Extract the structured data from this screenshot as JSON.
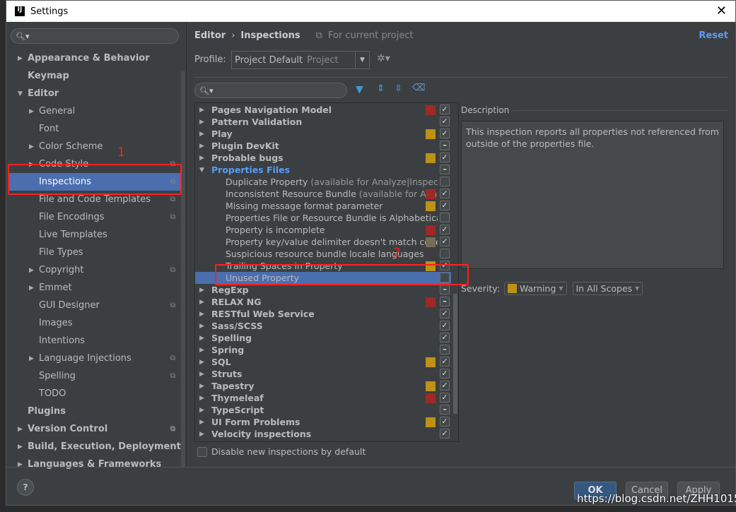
{
  "window": {
    "title": "Settings",
    "close": "✕"
  },
  "sidebar": {
    "items": [
      {
        "label": "Appearance & Behavior",
        "level": 0,
        "arrow": "right",
        "bold": true
      },
      {
        "label": "Keymap",
        "level": 0,
        "bold": true
      },
      {
        "label": "Editor",
        "level": 0,
        "arrow": "down",
        "bold": true
      },
      {
        "label": "General",
        "level": 1,
        "arrow": "right"
      },
      {
        "label": "Font",
        "level": 1
      },
      {
        "label": "Color Scheme",
        "level": 1,
        "arrow": "right"
      },
      {
        "label": "Code Style",
        "level": 1,
        "arrow": "right",
        "copy": true
      },
      {
        "label": "Inspections",
        "level": 1,
        "copy": true,
        "selected": true
      },
      {
        "label": "File and Code Templates",
        "level": 1,
        "copy": true
      },
      {
        "label": "File Encodings",
        "level": 1,
        "copy": true
      },
      {
        "label": "Live Templates",
        "level": 1
      },
      {
        "label": "File Types",
        "level": 1
      },
      {
        "label": "Copyright",
        "level": 1,
        "arrow": "right",
        "copy": true
      },
      {
        "label": "Emmet",
        "level": 1,
        "arrow": "right"
      },
      {
        "label": "GUI Designer",
        "level": 1,
        "copy": true
      },
      {
        "label": "Images",
        "level": 1
      },
      {
        "label": "Intentions",
        "level": 1
      },
      {
        "label": "Language Injections",
        "level": 1,
        "arrow": "right",
        "copy": true
      },
      {
        "label": "Spelling",
        "level": 1,
        "copy": true
      },
      {
        "label": "TODO",
        "level": 1
      },
      {
        "label": "Plugins",
        "level": 0,
        "bold": true
      },
      {
        "label": "Version Control",
        "level": 0,
        "arrow": "right",
        "bold": true,
        "copy": true
      },
      {
        "label": "Build, Execution, Deployment",
        "level": 0,
        "arrow": "right",
        "bold": true
      },
      {
        "label": "Languages & Frameworks",
        "level": 0,
        "arrow": "right",
        "bold": true
      }
    ]
  },
  "header": {
    "crumb1": "Editor",
    "sep": "›",
    "crumb2": "Inspections",
    "scope": "For current project",
    "reset": "Reset"
  },
  "profile": {
    "label": "Profile:",
    "value": "Project Default",
    "hint": "Project"
  },
  "colors": {
    "error": "#9e2927",
    "warning": "#be9117",
    "weak": "#756d56",
    "accent": "#4b6eaf",
    "link": "#589df6"
  },
  "tree": {
    "rows": [
      {
        "label": "Pages Navigation Model",
        "group": true,
        "sev": "error",
        "check": "on"
      },
      {
        "label": "Pattern Validation",
        "group": true,
        "check": "on"
      },
      {
        "label": "Play",
        "group": true,
        "sev": "warning",
        "check": "on"
      },
      {
        "label": "Plugin DevKit",
        "group": true,
        "check": "mixed"
      },
      {
        "label": "Probable bugs",
        "group": true,
        "sev": "warning",
        "check": "on"
      },
      {
        "label": "Properties Files",
        "group": true,
        "expanded": true,
        "check": "mixed"
      },
      {
        "label": "Duplicate Property",
        "hint": " (available for Analyze|Inspect Code)",
        "check": "off"
      },
      {
        "label": "Inconsistent Resource Bundle",
        "hint": " (available for Analyze|Inspect Code)",
        "sev": "error",
        "check": "on"
      },
      {
        "label": "Missing message format parameter",
        "sev": "warning",
        "check": "on"
      },
      {
        "label": "Properties File or Resource Bundle is Alphabetically Sorted",
        "check": "off"
      },
      {
        "label": "Property is incomplete",
        "sev": "error",
        "check": "on"
      },
      {
        "label": "Property key/value delimiter doesn't match code style",
        "sev": "weak",
        "check": "on"
      },
      {
        "label": "Suspicious resource bundle locale languages",
        "check": "off"
      },
      {
        "label": "Trailing Spaces in Property",
        "sev": "warning",
        "check": "on"
      },
      {
        "label": "Unused Property",
        "check": "off",
        "selected": true
      },
      {
        "label": "RegExp",
        "group": true,
        "check": "mixed"
      },
      {
        "label": "RELAX NG",
        "group": true,
        "sev": "error",
        "check": "mixed"
      },
      {
        "label": "RESTful Web Service",
        "group": true,
        "check": "on"
      },
      {
        "label": "Sass/SCSS",
        "group": true,
        "check": "on"
      },
      {
        "label": "Spelling",
        "group": true,
        "check": "on"
      },
      {
        "label": "Spring",
        "group": true,
        "check": "mixed"
      },
      {
        "label": "SQL",
        "group": true,
        "sev": "warning",
        "check": "on"
      },
      {
        "label": "Struts",
        "group": true,
        "check": "on"
      },
      {
        "label": "Tapestry",
        "group": true,
        "sev": "warning",
        "check": "on"
      },
      {
        "label": "Thymeleaf",
        "group": true,
        "sev": "error",
        "check": "on"
      },
      {
        "label": "TypeScript",
        "group": true,
        "check": "mixed"
      },
      {
        "label": "UI Form Problems",
        "group": true,
        "sev": "warning",
        "check": "on"
      },
      {
        "label": "Velocity inspections",
        "group": true,
        "check": "on"
      }
    ]
  },
  "disable_new": "Disable new inspections by default",
  "description": {
    "label": "Description",
    "text": "This inspection reports all properties not referenced from outside of the properties file."
  },
  "severity": {
    "label": "Severity:",
    "value": "Warning",
    "scope": "In All Scopes"
  },
  "annotations": {
    "one": "1",
    "two": "2"
  },
  "buttons": {
    "help": "?",
    "ok": "OK",
    "cancel": "Cancel",
    "apply": "Apply"
  },
  "watermark": "https://blog.csdn.net/ZHH1015"
}
